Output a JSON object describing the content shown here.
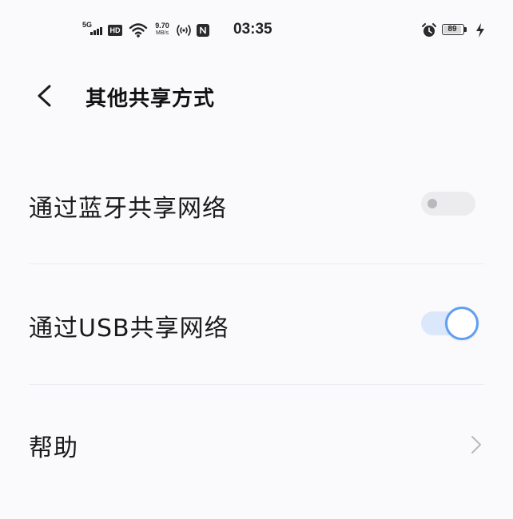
{
  "status_bar": {
    "network": "5G",
    "hd_badge": "HD",
    "speed_value": "9.70",
    "speed_unit": "MB/s",
    "time": "03:35",
    "battery": "89"
  },
  "header": {
    "title": "其他共享方式"
  },
  "settings": [
    {
      "label": "通过蓝牙共享网络",
      "type": "switch",
      "enabled": false
    },
    {
      "label": "通过USB共享网络",
      "type": "switch",
      "enabled": true
    },
    {
      "label": "帮助",
      "type": "link"
    }
  ],
  "colors": {
    "accent": "#5f9ff0",
    "track_on": "#dbe8fb",
    "track_off": "#ececef",
    "background": "#fafafc"
  },
  "icons": {
    "back": "chevron-left-icon",
    "help_arrow": "chevron-right-icon"
  }
}
